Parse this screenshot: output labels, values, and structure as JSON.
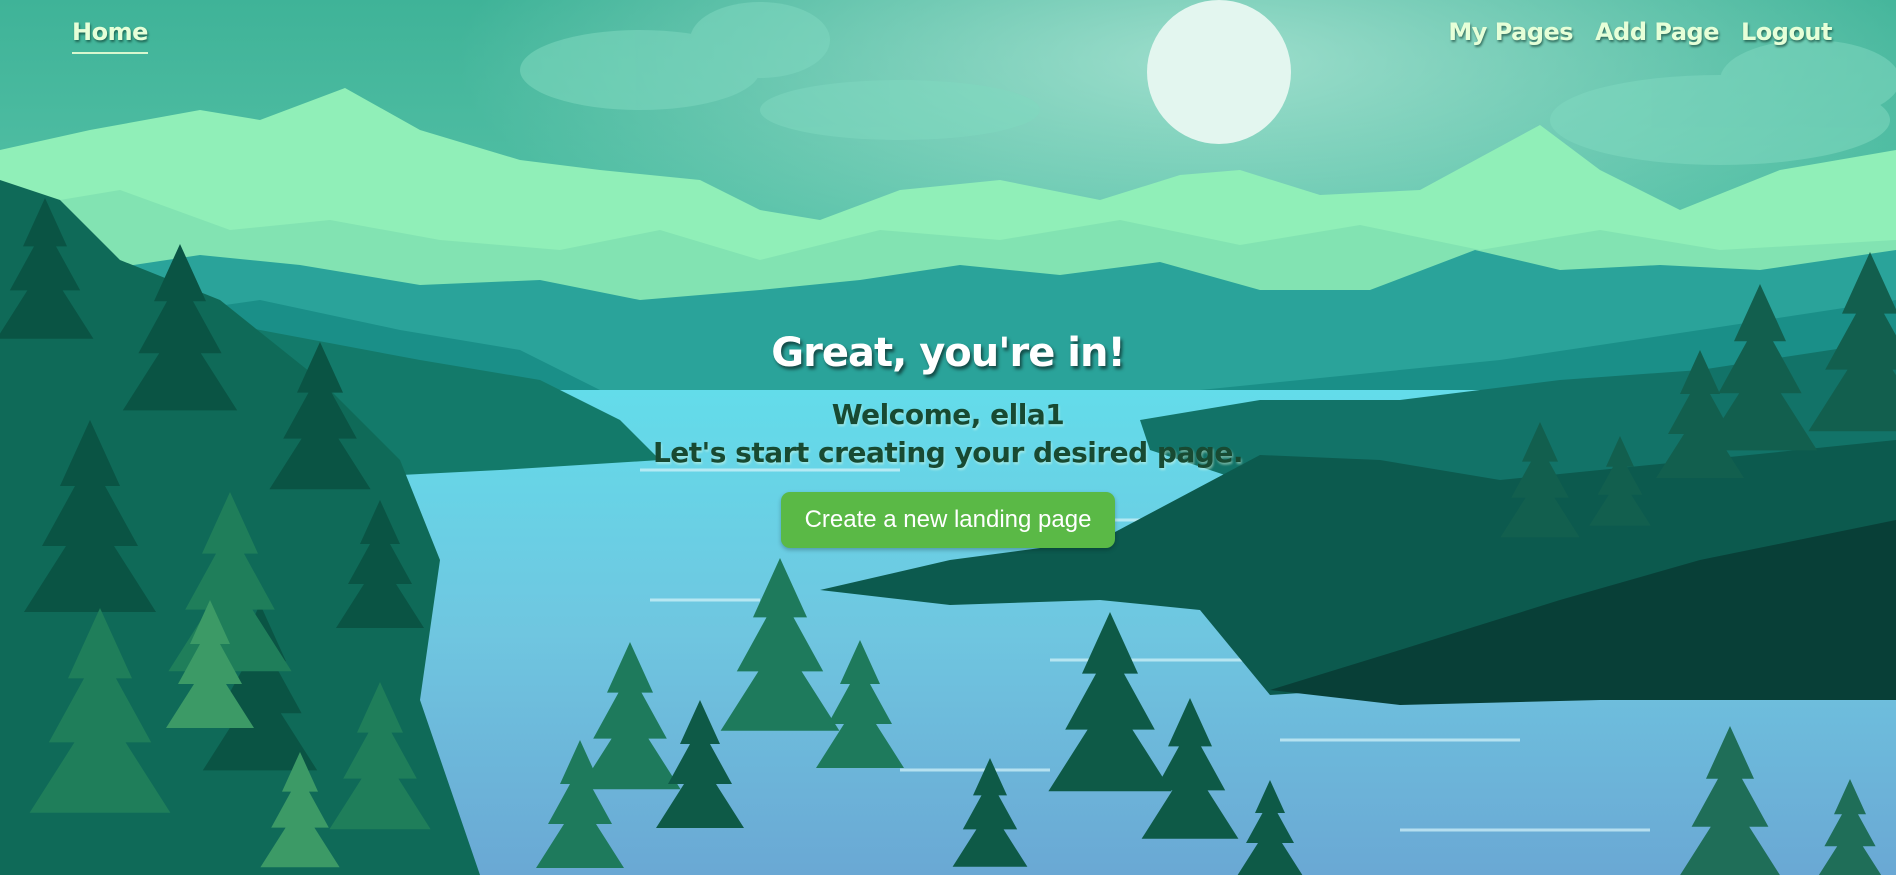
{
  "nav": {
    "home_label": "Home",
    "my_pages_label": "My Pages",
    "add_page_label": "Add Page",
    "logout_label": "Logout"
  },
  "hero": {
    "title": "Great, you're in!",
    "welcome_line": "Welcome, ella1",
    "subtitle_line": "Let's start creating your desired page.",
    "cta_label": "Create a new landing page"
  },
  "colors": {
    "sky": "#5fc8b0",
    "moon": "#e3f6ef",
    "lake": "#63d3e6",
    "button": "#5ab946",
    "nav_text": "#e6ffd8",
    "welcome_text": "#184a32"
  },
  "icons": {
    "background": "landscape-illustration"
  }
}
